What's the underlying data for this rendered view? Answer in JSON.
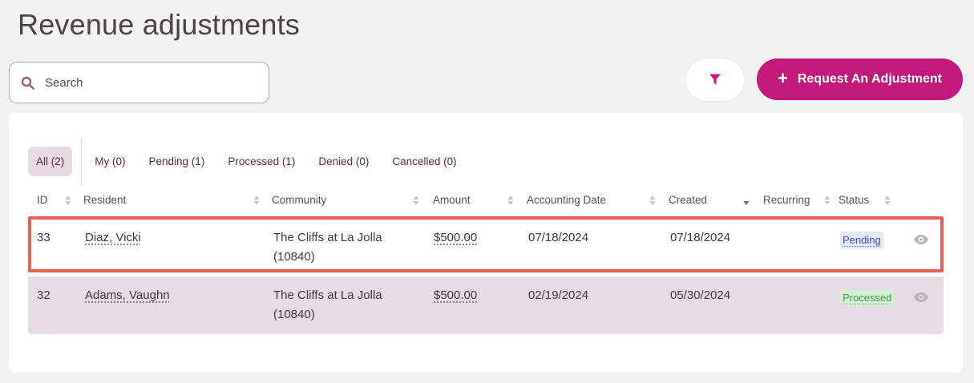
{
  "page": {
    "title": "Revenue adjustments"
  },
  "search": {
    "placeholder": "Search",
    "icon": "search-icon"
  },
  "toolbar": {
    "filter_icon": "filter-icon",
    "request_label": "Request An Adjustment",
    "request_icon": "plus-icon"
  },
  "colors": {
    "brand": "#c2197a",
    "active_tab_bg": "#e7dbe2",
    "highlight_border": "#ef5f51",
    "pending_bg": "#e4e6f7",
    "processed_bg": "#d6eed8"
  },
  "tabs": [
    {
      "label": "All (2)",
      "active": true
    },
    {
      "label": "My (0)",
      "active": false
    },
    {
      "label": "Pending (1)",
      "active": false
    },
    {
      "label": "Processed (1)",
      "active": false
    },
    {
      "label": "Denied (0)",
      "active": false
    },
    {
      "label": "Cancelled (0)",
      "active": false
    }
  ],
  "table": {
    "columns": [
      "ID",
      "Resident",
      "Community",
      "Amount",
      "Accounting Date",
      "Created",
      "Recurring",
      "Status"
    ],
    "sorted_by": "Created",
    "sort_direction": "desc",
    "rows": [
      {
        "id": "33",
        "resident": "Diaz, Vicki",
        "community_line1": "The Cliffs at La Jolla",
        "community_line2": "(10840)",
        "amount": "$500.00",
        "accounting_date": "07/18/2024",
        "created": "07/18/2024",
        "recurring": "",
        "status": "Pending",
        "highlighted": true
      },
      {
        "id": "32",
        "resident": "Adams, Vaughn",
        "community_line1": "The Cliffs at La Jolla",
        "community_line2": "(10840)",
        "amount": "$500.00",
        "accounting_date": "02/19/2024",
        "created": "05/30/2024",
        "recurring": "",
        "status": "Processed",
        "highlighted": false
      }
    ]
  }
}
